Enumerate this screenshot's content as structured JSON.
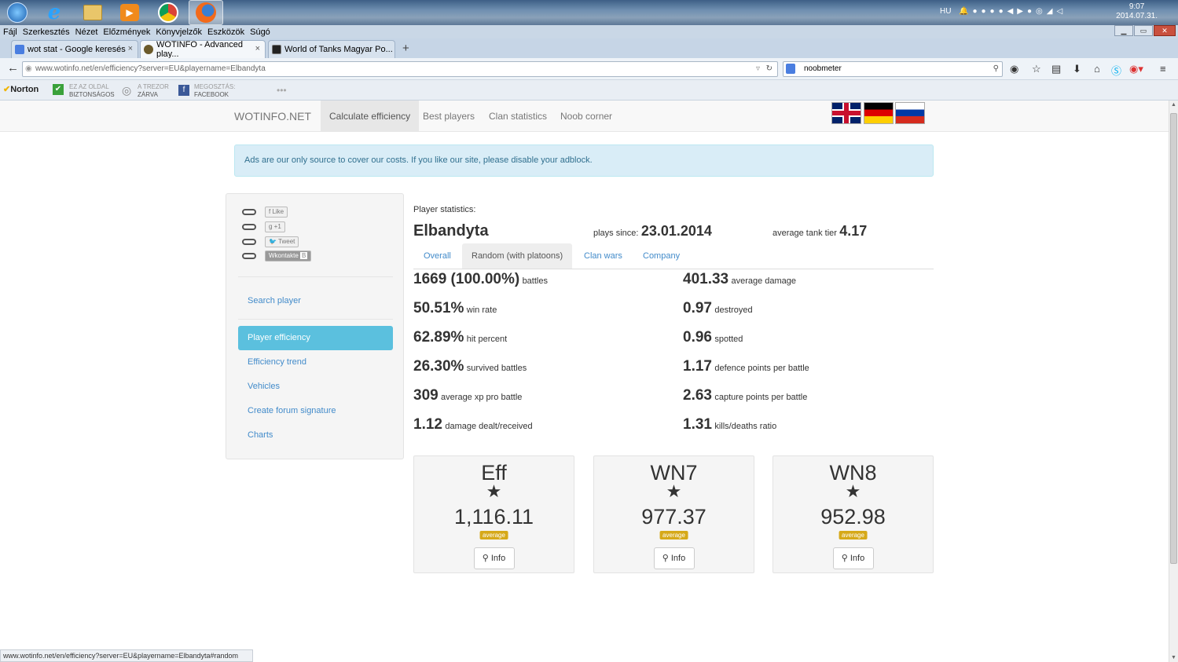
{
  "taskbar": {
    "lang": "HU",
    "clock_time": "9:07",
    "clock_date": "2014.07.31."
  },
  "menu": [
    "Fájl",
    "Szerkesztés",
    "Nézet",
    "Előzmények",
    "Könyvjelzők",
    "Eszközök",
    "Súgó"
  ],
  "tabs": [
    {
      "label": "wot stat - Google keresés",
      "close": "×"
    },
    {
      "label": "WOTINFO - Advanced play...",
      "close": "×"
    },
    {
      "label": "World of Tanks Magyar Po...",
      "close": "×"
    }
  ],
  "new_tab": "+",
  "address": {
    "url": "www.wotinfo.net/en/efficiency?server=EU&playername=Elbandyta"
  },
  "search": {
    "value": "noobmeter"
  },
  "norton": {
    "brand": "Norton",
    "safe_top": "EZ AZ OLDAL",
    "safe_bottom": "BIZTONSÁGOS",
    "vault_top": "A TREZOR",
    "vault_bottom": "ZÁRVA",
    "share_top": "MEGOSZTÁS:",
    "share_bottom": "FACEBOOK",
    "more": "•••"
  },
  "site": {
    "brand": "WOTINFO.NET",
    "nav": [
      "Calculate efficiency",
      "Best players",
      "Clan statistics",
      "Noob corner"
    ]
  },
  "ad_text": "Ads are our only source to cover our costs. If you like our site, please disable your adblock.",
  "share": [
    "Like",
    "+1",
    "Tweet",
    "Wkontakte"
  ],
  "share_vk_b": "B",
  "sidebar": {
    "search": "Search player",
    "links": [
      "Player efficiency",
      "Efficiency trend",
      "Vehicles",
      "Create forum signature",
      "Charts"
    ]
  },
  "player": {
    "stats_label": "Player statistics:",
    "name": "Elbandyta",
    "since_label": "plays since:",
    "since": "23.01.2014",
    "tier_label": "average tank tier",
    "tier": "4.17"
  },
  "player_tabs": [
    "Overall",
    "Random (with platoons)",
    "Clan wars",
    "Company"
  ],
  "stats_left": [
    {
      "value": "1669 (100.00%)",
      "label": "battles"
    },
    {
      "value": "50.51%",
      "label": "win rate"
    },
    {
      "value": "62.89%",
      "label": "hit percent"
    },
    {
      "value": "26.30%",
      "label": "survived battles"
    },
    {
      "value": "309",
      "label": "average xp pro battle"
    },
    {
      "value": "1.12",
      "label": "damage dealt/received"
    }
  ],
  "stats_right": [
    {
      "value": "401.33",
      "label": "average damage"
    },
    {
      "value": "0.97",
      "label": "destroyed"
    },
    {
      "value": "0.96",
      "label": "spotted"
    },
    {
      "value": "1.17",
      "label": "defence points per battle"
    },
    {
      "value": "2.63",
      "label": "capture points per battle"
    },
    {
      "value": "1.31",
      "label": "kills/deaths ratio"
    }
  ],
  "ratings": [
    {
      "title": "Eff",
      "star": "★",
      "value": "1,116.11",
      "badge": "average",
      "button": "Info"
    },
    {
      "title": "WN7",
      "star": "★",
      "value": "977.37",
      "badge": "average",
      "button": "Info"
    },
    {
      "title": "WN8",
      "star": "★",
      "value": "952.98",
      "badge": "average",
      "button": "Info"
    }
  ],
  "statusbar": "www.wotinfo.net/en/efficiency?server=EU&playername=Elbandyta#random",
  "colors": {
    "link": "#428bca",
    "active_side": "#5bc0de",
    "badge": "#d6a919",
    "ad_bg": "#d9edf7"
  }
}
